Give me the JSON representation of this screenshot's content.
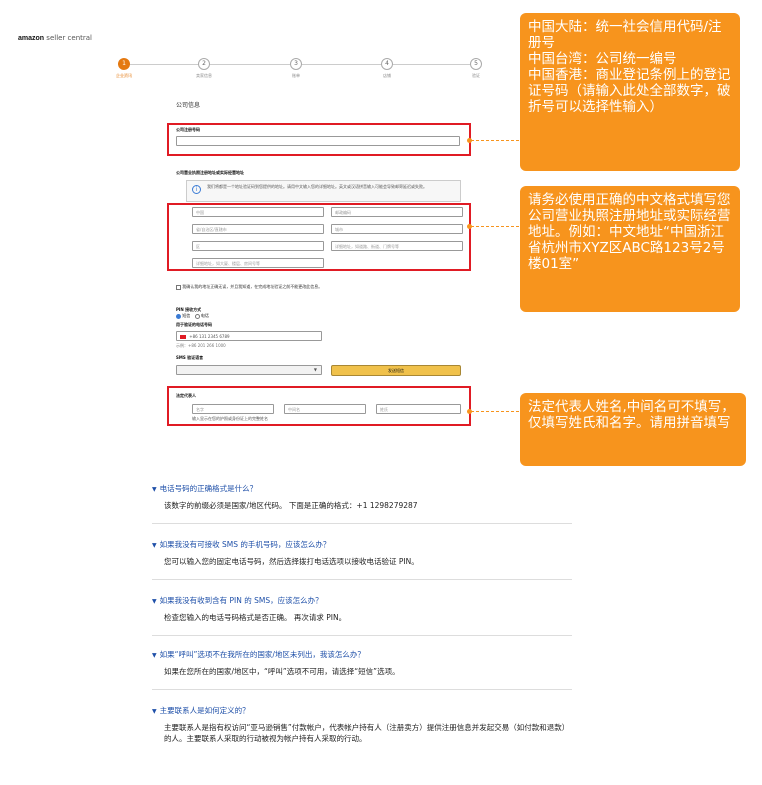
{
  "header": {
    "brand": "amazon",
    "product": "seller central"
  },
  "steps": [
    {
      "num": "1",
      "label": "企业资讯"
    },
    {
      "num": "2",
      "label": "卖家信息"
    },
    {
      "num": "3",
      "label": "账单"
    },
    {
      "num": "4",
      "label": "店铺"
    },
    {
      "num": "5",
      "label": "验证"
    }
  ],
  "form": {
    "section_title": "公司信息",
    "reg_number_label": "公司注册号码",
    "address_label": "公司营业执照注册地址或实际经营地址",
    "info_text": "我们将都是一个地址验证码到您提供的地址。请用中文输入您的详细地址。英文或汉语拼音输入可能会导致邮寄延迟或失败。",
    "country_placeholder": "中国",
    "postal_placeholder": "邮政编码",
    "province_placeholder": "省/自治区/直辖市",
    "city_placeholder": "城市",
    "district_placeholder": "区",
    "address1_placeholder": "详细地址，如道路、街道、门牌号等",
    "address2_placeholder": "详细地址，如大厦、楼层、房间号等",
    "confirm_text": "我确认我的地址正确无误，并且我知道，在完成地址验证之前不能更改此信息。",
    "pin_label": "PIN 接收方式",
    "pin_sms": "短信",
    "pin_call": "电话",
    "phone_label": "用于验证的电话号码",
    "phone_placeholder": "+86 131 2345 6789",
    "phone_example": "示例：+86 201 266 1000",
    "sms_lang_label": "SMS 验证语言",
    "send_button": "发送短信",
    "rep_label": "法定代表人",
    "first_name_placeholder": "名字",
    "middle_name_placeholder": "中间名",
    "last_name_placeholder": "姓氏",
    "rep_hint": "输入显示在您的护照或身份证上的完整姓名"
  },
  "callouts": {
    "c1": "中国大陆：统一社会信用代码/注册号\n中国台湾：公司统一编号\n中国香港：商业登记条例上的登记证号码（请输入此处全部数字，破折号可以选择性输入）",
    "c2": "请务必使用正确的中文格式填写您公司营业执照注册地址或实际经营地址。例如：中文地址“中国浙江省杭州市XYZ区ABC路123号2号楼01室”",
    "c3": "法定代表人姓名,中间名可不填写，仅填写姓氏和名字。请用拼音填写"
  },
  "faq": [
    {
      "q": "电话号码的正确格式是什么？",
      "a": "该数字的前缀必须是国家/地区代码。 下面是正确的格式：+1 1298279287"
    },
    {
      "q": "如果我没有可接收 SMS 的手机号码，应该怎么办？",
      "a": "您可以输入您的固定电话号码，然后选择拨打电话选项以接收电话验证 PIN。"
    },
    {
      "q": "如果我没有收到含有 PIN 的 SMS，应该怎么办？",
      "a": "检查您输入的电话号码格式是否正确。 再次请求 PIN。"
    },
    {
      "q": "如果“呼叫”选项不在我所在的国家/地区未列出，我该怎么办？",
      "a": "如果在您所在的国家/地区中，“呼叫”选项不可用，请选择“短信”选项。"
    },
    {
      "q": "主要联系人是如何定义的？",
      "a": "主要联系人是指有权访问“亚马逊销售”付款帐户，代表帐户持有人（注册卖方）提供注册信息并发起交易（如付款和退款）的人。主要联系人采取的行动被视为帐户持有人采取的行动。"
    }
  ],
  "colors": {
    "accent": "#f7941d",
    "highlight": "#e01b24",
    "link": "#1e4fa8"
  }
}
